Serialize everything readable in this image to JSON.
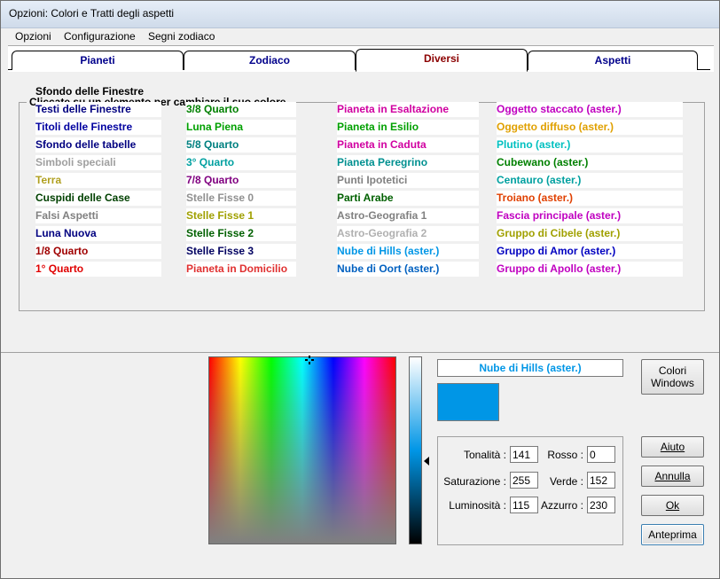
{
  "window": {
    "title": "Opzioni:  Colori e Tratti degli aspetti"
  },
  "menu": [
    "Opzioni",
    "Configurazione",
    "Segni zodiaco"
  ],
  "tabs": [
    {
      "label": "Pianeti",
      "active": false
    },
    {
      "label": "Zodiaco",
      "active": false
    },
    {
      "label": "Diversi",
      "active": true
    },
    {
      "label": "Aspetti",
      "active": false
    }
  ],
  "group": {
    "title": "Cliccate su un elemento per cambiare il suo colore",
    "first": {
      "label": "Sfondo delle Finestre",
      "color": "#000000"
    },
    "columns": [
      [
        {
          "label": "Testi delle Finestre",
          "color": "#000080"
        },
        {
          "label": "Titoli delle Finestre",
          "color": "#0000a0"
        },
        {
          "label": "Sfondo delle tabelle",
          "color": "#000080"
        },
        {
          "label": "Simboli speciali",
          "color": "#a0a0a0"
        },
        {
          "label": "Terra",
          "color": "#b0a020"
        },
        {
          "label": "Cuspidi delle Case",
          "color": "#004000"
        },
        {
          "label": "Falsi Aspetti",
          "color": "#808080"
        },
        {
          "label": "Luna Nuova",
          "color": "#000080"
        },
        {
          "label": "1/8 Quarto",
          "color": "#a00000"
        },
        {
          "label": "1° Quarto",
          "color": "#e00000"
        }
      ],
      [
        {
          "label": "3/8 Quarto",
          "color": "#008000"
        },
        {
          "label": "Luna Piena",
          "color": "#00a000"
        },
        {
          "label": "5/8 Quarto",
          "color": "#008080"
        },
        {
          "label": "3° Quarto",
          "color": "#00a0a0"
        },
        {
          "label": "7/8 Quarto",
          "color": "#800080"
        },
        {
          "label": "Stelle Fisse 0",
          "color": "#909090"
        },
        {
          "label": "Stelle Fisse 1",
          "color": "#a0a000"
        },
        {
          "label": "Stelle Fisse 2",
          "color": "#006000"
        },
        {
          "label": "Stelle Fisse 3",
          "color": "#000060"
        },
        {
          "label": "Pianeta in Domicilio",
          "color": "#e03030"
        }
      ],
      [
        {
          "label": "Pianeta in Esaltazione",
          "color": "#d000a0"
        },
        {
          "label": "Pianeta in Esilio",
          "color": "#00a000"
        },
        {
          "label": "Pianeta in Caduta",
          "color": "#d000a0"
        },
        {
          "label": "Pianeta Peregrino",
          "color": "#009090"
        },
        {
          "label": "Punti Ipotetici",
          "color": "#808080"
        },
        {
          "label": "Parti Arabe",
          "color": "#006000"
        },
        {
          "label": "Astro-Geografia 1",
          "color": "#808080"
        },
        {
          "label": "Astro-Geografia 2",
          "color": "#b0b0b0"
        },
        {
          "label": "Nube di Hills (aster.)",
          "color": "#0096e6",
          "selected": true
        },
        {
          "label": "Nube di Oort (aster.)",
          "color": "#0060c0"
        }
      ],
      [
        {
          "label": "Oggetto staccato (aster.)",
          "color": "#c000c0"
        },
        {
          "label": "Oggetto diffuso (aster.)",
          "color": "#e0a000"
        },
        {
          "label": "Plutino (aster.)",
          "color": "#00c0c0"
        },
        {
          "label": "Cubewano (aster.)",
          "color": "#008000"
        },
        {
          "label": "Centauro (aster.)",
          "color": "#00a0a0"
        },
        {
          "label": "Troiano (aster.)",
          "color": "#e04000"
        },
        {
          "label": "Fascia principale (aster.)",
          "color": "#c000c0"
        },
        {
          "label": "Gruppo di Cibele (aster.)",
          "color": "#a0a000"
        },
        {
          "label": "Gruppo di Amor (aster.)",
          "color": "#0000c0"
        },
        {
          "label": "Gruppo di Apollo (aster.)",
          "color": "#c000c0"
        }
      ]
    ]
  },
  "color_editor": {
    "selected_name": "Nube di Hills (aster.)",
    "selected_color": "#0096e6",
    "fields": {
      "tonalita": {
        "label": "Tonalità :",
        "value": "141"
      },
      "saturazione": {
        "label": "Saturazione :",
        "value": "255"
      },
      "luminosita": {
        "label": "Luminosità :",
        "value": "115"
      },
      "rosso": {
        "label": "Rosso :",
        "value": "0"
      },
      "verde": {
        "label": "Verde :",
        "value": "152"
      },
      "azzurro": {
        "label": "Azzurro :",
        "value": "230"
      }
    }
  },
  "buttons": {
    "colori_windows": "Colori Windows",
    "aiuto": "Aiuto",
    "annulla": "Annulla",
    "ok": "Ok",
    "anteprima": "Anteprima"
  }
}
